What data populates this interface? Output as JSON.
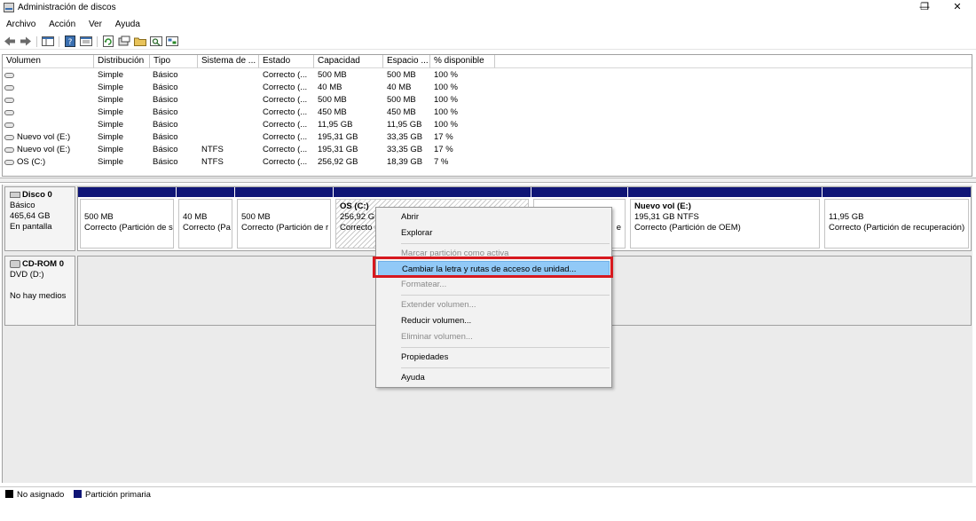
{
  "window": {
    "title": "Administración de discos",
    "minimize_glyph": "—",
    "maximize_glyph": "❐",
    "close_glyph": "✕"
  },
  "menu": [
    "Archivo",
    "Acción",
    "Ver",
    "Ayuda"
  ],
  "toolbar": {
    "icons": [
      "back-icon",
      "forward-icon",
      "console-tree-icon",
      "help-icon",
      "properties-icon",
      "refresh-icon",
      "rescan-icon",
      "open-folder-icon",
      "explore-icon",
      "settings-icon"
    ]
  },
  "volume_table": {
    "columns": [
      "Volumen",
      "Distribución",
      "Tipo",
      "Sistema de ...",
      "Estado",
      "Capacidad",
      "Espacio ...",
      "% disponible"
    ],
    "rows": [
      [
        "",
        "Simple",
        "Básico",
        "",
        "Correcto (...",
        "500 MB",
        "500 MB",
        "100 %"
      ],
      [
        "",
        "Simple",
        "Básico",
        "",
        "Correcto (...",
        "40 MB",
        "40 MB",
        "100 %"
      ],
      [
        "",
        "Simple",
        "Básico",
        "",
        "Correcto (...",
        "500 MB",
        "500 MB",
        "100 %"
      ],
      [
        "",
        "Simple",
        "Básico",
        "",
        "Correcto (...",
        "450 MB",
        "450 MB",
        "100 %"
      ],
      [
        "",
        "Simple",
        "Básico",
        "",
        "Correcto (...",
        "11,95 GB",
        "11,95 GB",
        "100 %"
      ],
      [
        "Nuevo vol (E:)",
        "Simple",
        "Básico",
        "",
        "Correcto (...",
        "195,31 GB",
        "33,35 GB",
        "17 %"
      ],
      [
        "Nuevo vol (E:)",
        "Simple",
        "Básico",
        "NTFS",
        "Correcto (...",
        "195,31 GB",
        "33,35 GB",
        "17 %"
      ],
      [
        "OS (C:)",
        "Simple",
        "Básico",
        "NTFS",
        "Correcto (...",
        "256,92 GB",
        "18,39 GB",
        "7 %"
      ]
    ]
  },
  "disk0": {
    "name": "Disco 0",
    "type": "Básico",
    "size": "465,64 GB",
    "status": "En pantalla",
    "partitions": [
      {
        "name": "",
        "size": "500 MB",
        "status": "Correcto (Partición de s"
      },
      {
        "name": "",
        "size": "40 MB",
        "status": "Correcto (Pa"
      },
      {
        "name": "",
        "size": "500 MB",
        "status": "Correcto (Partición de r"
      },
      {
        "name": "OS  (C:)",
        "size": "256,92 GB",
        "status": "Correcto ("
      },
      {
        "name": "",
        "size": "",
        "status": "e"
      },
      {
        "name": "Nuevo vol  (E:)",
        "size": "195,31 GB NTFS",
        "status": "Correcto (Partición de OEM)"
      },
      {
        "name": "",
        "size": "11,95 GB",
        "status": "Correcto (Partición de recuperación)"
      }
    ]
  },
  "cdrom0": {
    "name": "CD-ROM 0",
    "drive": "DVD (D:)",
    "media": "No hay medios"
  },
  "legend": {
    "unallocated": {
      "label": "No asignado",
      "color": "#000000"
    },
    "primary": {
      "label": "Partición primaria",
      "color": "#0f1576"
    }
  },
  "context_menu": {
    "items": [
      {
        "label": "Abrir",
        "enabled": true
      },
      {
        "label": "Explorar",
        "enabled": true
      },
      {
        "label": "Marcar partición como activa",
        "enabled": false
      },
      {
        "label": "Cambiar la letra y rutas de acceso de unidad...",
        "enabled": true,
        "highlighted": true
      },
      {
        "label": "Formatear...",
        "enabled": false
      },
      {
        "label": "Extender volumen...",
        "enabled": false
      },
      {
        "label": "Reducir volumen...",
        "enabled": true
      },
      {
        "label": "Eliminar volumen...",
        "enabled": false
      },
      {
        "label": "Propiedades",
        "enabled": true
      },
      {
        "label": "Ayuda",
        "enabled": true
      }
    ]
  },
  "colors": {
    "partition_bar": "#0f1576",
    "highlight": "#91c9f7",
    "callout_red": "#d7191f"
  }
}
